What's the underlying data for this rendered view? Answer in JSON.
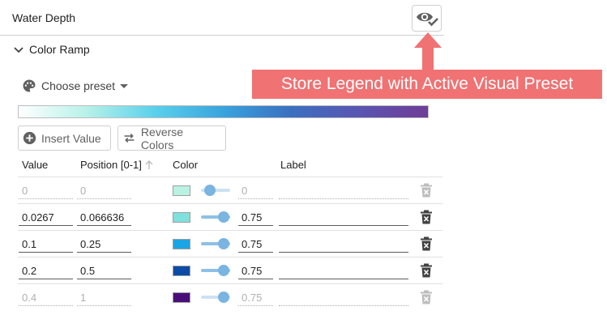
{
  "layer": {
    "title": "Water Depth"
  },
  "section": {
    "title": "Color Ramp"
  },
  "preset": {
    "label": "Choose preset"
  },
  "ramp": {
    "gradient_colors": [
      "#ffffff",
      "#b7f1e8",
      "#5ad0ec",
      "#3aa3dd",
      "#3b6fc0",
      "#5a55b1",
      "#6f3d97"
    ]
  },
  "buttons": {
    "insert_label": "Insert Value",
    "reverse_label": "Reverse Colors"
  },
  "table": {
    "headers": {
      "value": "Value",
      "position": "Position [0-1]",
      "color": "Color",
      "label": "Label"
    },
    "rows": [
      {
        "value": "0",
        "position": "0",
        "color": "#b9f2e3",
        "opacity": "0",
        "opacity_fraction": 0.0,
        "label": "",
        "disabled": true
      },
      {
        "value": "0.0267",
        "position": "0.066636",
        "color": "#7fe0dd",
        "opacity": "0.75",
        "opacity_fraction": 0.75,
        "label": "",
        "disabled": false
      },
      {
        "value": "0.1",
        "position": "0.25",
        "color": "#1aa6e4",
        "opacity": "0.75",
        "opacity_fraction": 0.75,
        "label": "",
        "disabled": false
      },
      {
        "value": "0.2",
        "position": "0.5",
        "color": "#0c4ca6",
        "opacity": "0.75",
        "opacity_fraction": 0.75,
        "label": "",
        "disabled": false
      },
      {
        "value": "0.4",
        "position": "1",
        "color": "#4a0e7a",
        "opacity": "0.75",
        "opacity_fraction": 0.75,
        "label": "",
        "disabled": true
      }
    ]
  },
  "annotation": {
    "text": "Store Legend with Active Visual Preset",
    "color": "#f07273"
  }
}
